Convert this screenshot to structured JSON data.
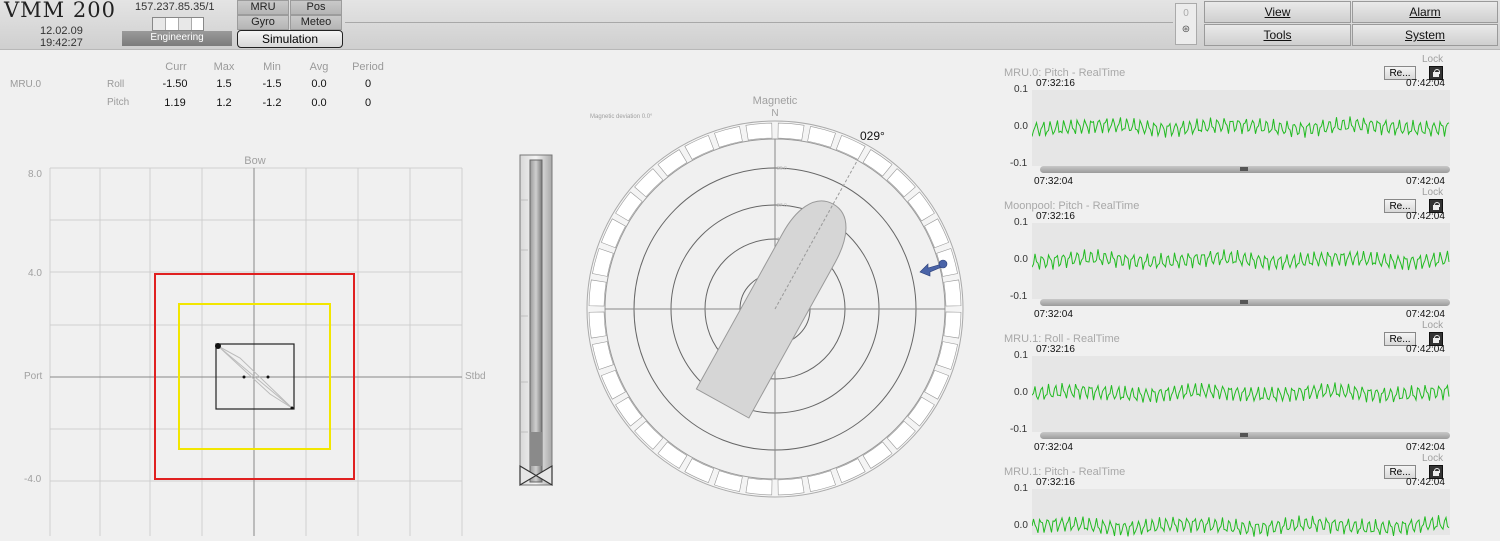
{
  "header": {
    "app_title": "VMM 200",
    "date": "12.02.09",
    "time": "19:42:27",
    "ip_address": "157.237.85.35/1",
    "mode_label": "Engineering",
    "tabs": [
      "MRU",
      "Pos",
      "Gyro",
      "Meteo"
    ],
    "simulation_label": "Simulation",
    "counter_value": "0",
    "menu": {
      "view": "View",
      "alarm": "Alarm",
      "tools": "Tools",
      "system": "System"
    }
  },
  "motion_table": {
    "sensor": "MRU.0",
    "columns": [
      "Curr",
      "Max",
      "Min",
      "Avg",
      "Period"
    ],
    "rows": [
      {
        "label": "Roll",
        "values": [
          "-1.50",
          "1.5",
          "-1.5",
          "0.0",
          "0"
        ]
      },
      {
        "label": "Pitch",
        "values": [
          "1.19",
          "1.2",
          "-1.2",
          "0.0",
          "0"
        ]
      }
    ]
  },
  "xy_plot": {
    "top_label": "Bow",
    "left_label": "Port",
    "right_label": "Stbd",
    "y_ticks": [
      "8.0",
      "4.0",
      "-4.0"
    ],
    "colors": {
      "red_limit": "#e02020",
      "yellow_limit": "#f2e600",
      "trace": "#222222"
    }
  },
  "compass": {
    "title": "Magnetic",
    "north_label": "N",
    "deviation_text": "Magnetic deviation 0.0°",
    "heading_label": "029°",
    "heading_deg": 29
  },
  "trends": [
    {
      "title": "MRU.0: Pitch - RealTime",
      "lock": "Lock",
      "reset": "Re...",
      "t_start": "07:32:16",
      "t_end": "07:42:04",
      "axis_start": "07:32:04",
      "axis_end": "07:42:04",
      "ticks": [
        "0.1",
        "0.0",
        "-0.1"
      ]
    },
    {
      "title": "Moonpool: Pitch - RealTime",
      "lock": "Lock",
      "reset": "Re...",
      "t_start": "07:32:16",
      "t_end": "07:42:04",
      "axis_start": "07:32:04",
      "axis_end": "07:42:04",
      "ticks": [
        "0.1",
        "0.0",
        "-0.1"
      ]
    },
    {
      "title": "MRU.1: Roll - RealTime",
      "lock": "Lock",
      "reset": "Re...",
      "t_start": "07:32:16",
      "t_end": "07:42:04",
      "axis_start": "07:32:04",
      "axis_end": "07:42:04",
      "ticks": [
        "0.1",
        "0.0",
        "-0.1"
      ]
    },
    {
      "title": "MRU.1: Pitch - RealTime",
      "lock": "Lock",
      "reset": "Re...",
      "t_start": "07:32:16",
      "t_end": "07:42:04",
      "axis_start": "",
      "axis_end": "",
      "ticks": [
        "0.1",
        "0.0",
        ""
      ]
    }
  ],
  "trend_color": "#22bb22"
}
